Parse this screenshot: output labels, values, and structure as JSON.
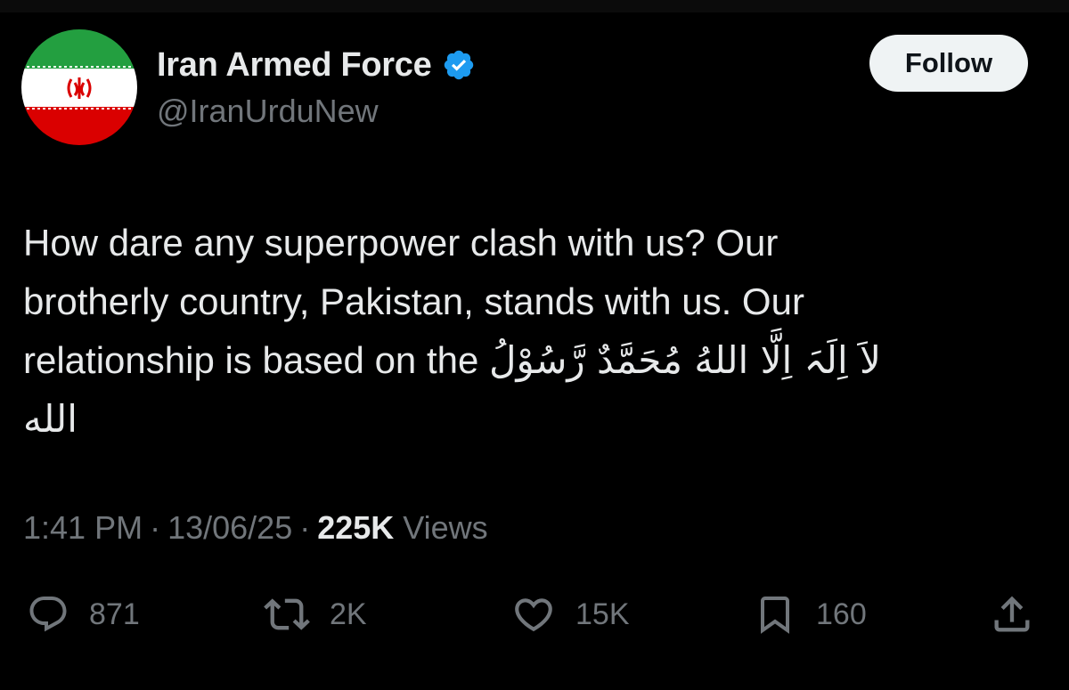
{
  "author": {
    "name": "Iran Armed Force",
    "handle": "@IranUrduNew",
    "verified": true,
    "avatar_icon": "iran-flag-avatar"
  },
  "follow_button": {
    "label": "Follow"
  },
  "tweet": {
    "lines": [
      "How dare any superpower clash with us? Our",
      "brotherly country, Pakistan, stands with us. Our"
    ],
    "line3_prefix": "relationship is based on the ",
    "arabic_line3": "لاَ اِلَہَ اِلَّا اللهُ مُحَمَّدٌ رَّسُوْلُ",
    "arabic_line4": "الله"
  },
  "meta": {
    "time": "1:41 PM",
    "separator": "·",
    "date": "13/06/25",
    "views_count": "225K",
    "views_label": "Views"
  },
  "actions": {
    "reply": {
      "icon": "reply-icon",
      "count": "871"
    },
    "repost": {
      "icon": "repost-icon",
      "count": "2K"
    },
    "like": {
      "icon": "heart-icon",
      "count": "15K"
    },
    "bookmark": {
      "icon": "bookmark-icon",
      "count": "160"
    },
    "share": {
      "icon": "share-icon"
    }
  },
  "colors": {
    "background": "#000000",
    "primary_text": "#e7e9ea",
    "secondary_text": "#71767b",
    "verified_blue": "#1d9bf0",
    "follow_bg": "#eff3f4"
  }
}
